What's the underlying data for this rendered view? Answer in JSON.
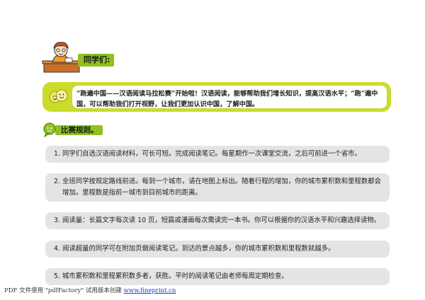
{
  "header": {
    "badge": "同学们:"
  },
  "intro": {
    "text": "“跑遍中国——汉语阅读马拉松赛”开始啦！汉语阅读，能够帮助我们增长知识，提高汉语水平；“跑”遍中国，可以帮助我们打开视野，让我们更加认识中国，了解中国。"
  },
  "rules": {
    "title": "比赛规则。",
    "items": [
      {
        "num": "1.",
        "text": "同学们自选汉语阅读材料，可长可短。完成阅读笔记。每星期作一次课堂交流，之后可前进一个省市。"
      },
      {
        "num": "2.",
        "text": "全班同学按规定路线前进。每到一个城市，请在地图上标出。随着行程的增加，你的城市累积数和里程数都会增加。里程数是指前一城市到目前城市的距离。"
      },
      {
        "num": "3.",
        "text": "阅读量：长篇文字每次读 10 页，短篇或漫画每次需读完一本书。你可以根据你的汉语水平和兴趣选择读物。"
      },
      {
        "num": "4.",
        "text": "阅读超量的同学可在附加页做阅读笔记。到达的景点越多，你的城市累积数和里程数就越多。"
      },
      {
        "num": "5.",
        "text": "城市累积数和里程累积数多者，获胜。平时的阅读笔记由老师每周定期检查。"
      }
    ]
  },
  "footer": {
    "prefix": "PDF 文件使用 \"pdfFactory\" 试用版本创建 ",
    "link": "www.fineprint.cn"
  },
  "colors": {
    "accent_green": "#8dc21f",
    "intro_yellow_green": "#c9dc2c",
    "rule_gray": "#e4e4e4",
    "link_blue": "#1a3cc4"
  }
}
